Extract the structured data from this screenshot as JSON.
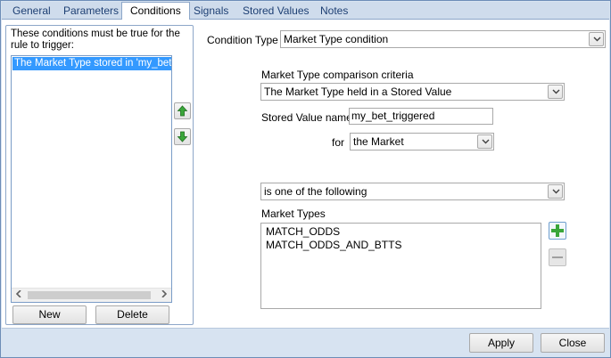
{
  "tabs": [
    {
      "label": "General"
    },
    {
      "label": "Parameters"
    },
    {
      "label": "Conditions",
      "active": true
    },
    {
      "label": "Signals"
    },
    {
      "label": "Stored Values"
    },
    {
      "label": "Notes"
    }
  ],
  "conditions_group": {
    "title": "These conditions must be true for the rule to trigger:",
    "items": [
      "The Market Type stored in 'my_bet_triggered'"
    ],
    "new_label": "New",
    "delete_label": "Delete"
  },
  "condition_type": {
    "label": "Condition Type",
    "value": "Market Type condition"
  },
  "criteria": {
    "label": "Market Type comparison criteria",
    "value": "The Market Type held in a Stored Value"
  },
  "stored_value": {
    "label": "Stored Value name",
    "value": "my_bet_triggered"
  },
  "for_field": {
    "label": "for",
    "value": "the Market"
  },
  "operator": {
    "value": "is one of the following"
  },
  "market_types": {
    "label": "Market Types",
    "items": [
      "MATCH_ODDS",
      "MATCH_ODDS_AND_BTTS"
    ]
  },
  "footer": {
    "apply_label": "Apply",
    "close_label": "Close"
  },
  "icons": {
    "move_up": "arrow-up-icon",
    "move_down": "arrow-down-icon",
    "add": "plus-icon",
    "remove": "minus-icon",
    "dropdown": "chevron-down-icon"
  },
  "colors": {
    "selection": "#3399ff",
    "tab_text": "#1d3f73",
    "frame": "#d7e3f1",
    "arrow_green": "#3aa63a"
  }
}
